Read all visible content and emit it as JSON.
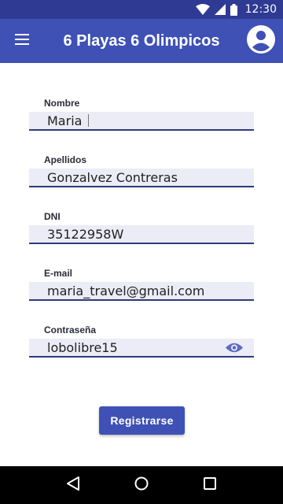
{
  "status_bar": {
    "time": "12:30",
    "icons": [
      "wifi-icon",
      "signal-icon",
      "battery-icon"
    ]
  },
  "app_bar": {
    "title": "6 Playas 6 Olimpicos",
    "left_icon": "menu-icon",
    "right_icon": "account-circle-icon"
  },
  "form": {
    "fields": [
      {
        "label": "Nombre",
        "value": "Maria"
      },
      {
        "label": "Apellidos",
        "value": "Gonzalvez Contreras"
      },
      {
        "label": "DNI",
        "value": "35122958W"
      },
      {
        "label": "E-mail",
        "value": "maria_travel@gmail.com"
      },
      {
        "label": "Contraseña",
        "value": "lobolibre15",
        "trailing_icon": "eye-icon"
      }
    ],
    "submit_label": "Registrarse"
  },
  "navigation_bar": {
    "icons": [
      "back-icon",
      "home-icon",
      "recents-icon"
    ]
  },
  "colors": {
    "primary": "#3f51b5",
    "primary_dark": "#2f3a93",
    "field_background": "#ebecf5",
    "field_underline": "#2f3a7a"
  }
}
